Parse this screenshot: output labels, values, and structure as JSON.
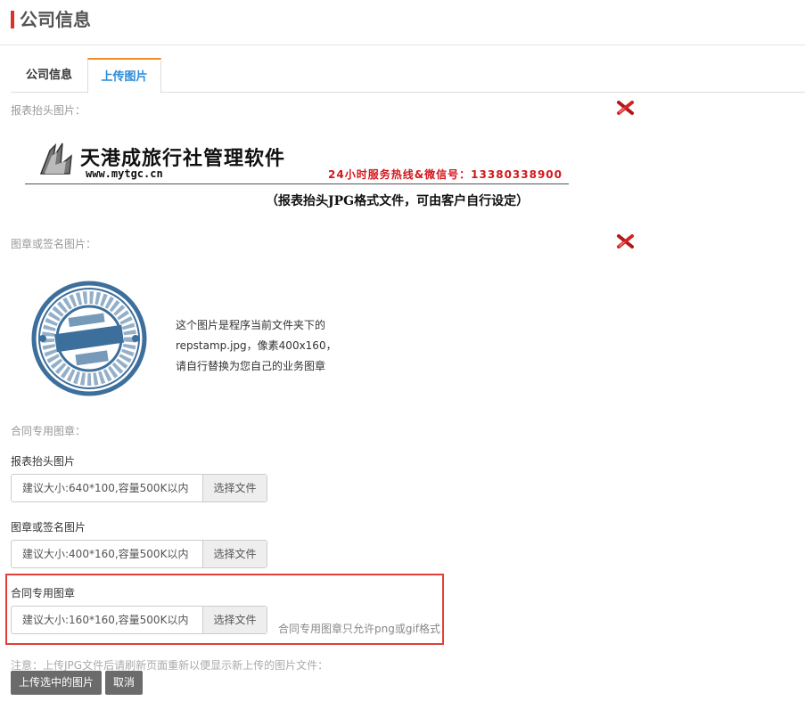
{
  "header": {
    "title": "公司信息"
  },
  "tabs": [
    {
      "label": "公司信息",
      "active": false
    },
    {
      "label": "上传图片",
      "active": true
    }
  ],
  "sections": {
    "report_header_label": "报表抬头图片：",
    "stamp_label": "图章或签名图片：",
    "contract_label": "合同专用图章："
  },
  "banner": {
    "brand": "天港成旅行社管理软件",
    "url": "www.mytgc.cn",
    "hotline": "24小时服务热线&微信号：13380338900",
    "note": "（报表抬头JPG格式文件，可由客户自行设定）"
  },
  "stamp": {
    "desc_lines": [
      "这个图片是程序当前文件夹下的",
      "repstamp.jpg，像素400x160，",
      "请自行替换为您自己的业务图章"
    ]
  },
  "uploads": [
    {
      "label": "报表抬头图片",
      "placeholder": "建议大小:640*100,容量500K以内",
      "button": "选择文件"
    },
    {
      "label": "图章或签名图片",
      "placeholder": "建议大小:400*160,容量500K以内",
      "button": "选择文件"
    },
    {
      "label": "合同专用图章",
      "placeholder": "建议大小:160*160,容量500K以内",
      "button": "选择文件",
      "hint": "合同专用图章只允许png或gif格式"
    }
  ],
  "notice": "注意：上传JPG文件后请刷新页面重新以便显示新上传的图片文件：",
  "actions": {
    "upload": "上传选中的图片",
    "cancel": "取消"
  },
  "colors": {
    "accent": "#d9342b",
    "tab_active": "#2a8bd8",
    "tab_top": "#f08a24",
    "highlight": "#e1403a",
    "button": "#6b6b6b"
  }
}
